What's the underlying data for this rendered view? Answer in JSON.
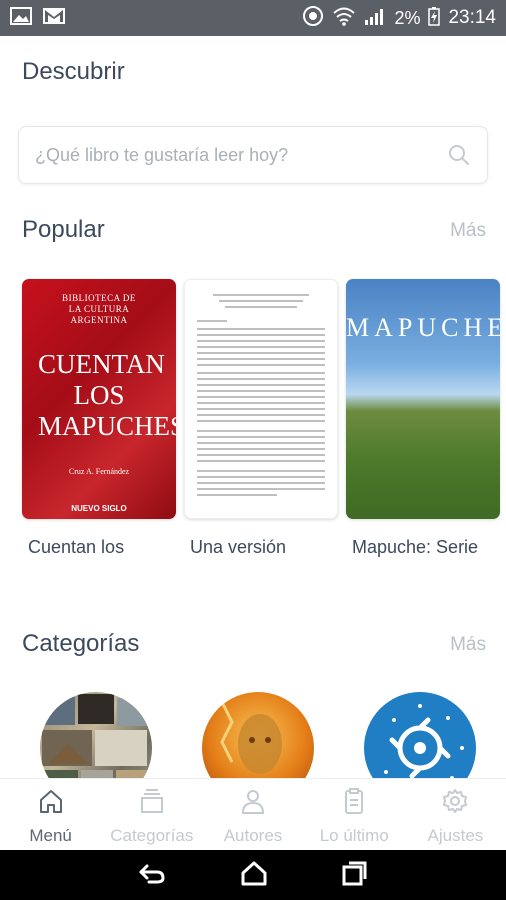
{
  "status_bar": {
    "battery": "2%",
    "time": "23:14"
  },
  "page": {
    "title": "Descubrir"
  },
  "search": {
    "placeholder": "¿Qué libro te gustaría leer hoy?"
  },
  "popular": {
    "title": "Popular",
    "more": "Más",
    "books": [
      {
        "label": "Cuentan los",
        "cover": {
          "header": "BIBLIOTECA DE LA CULTURA ARGENTINA",
          "title": "CUENTAN LOS MAPUCHES",
          "author": "Cruz A. Fernández",
          "publisher": "NUEVO SIGLO"
        }
      },
      {
        "label": "Una versión",
        "cover": {}
      },
      {
        "label": "Mapuche: Serie",
        "cover": {
          "title": "MAPUCHE"
        }
      }
    ]
  },
  "categories": {
    "title": "Categorías",
    "more": "Más"
  },
  "tabbar": {
    "tabs": [
      {
        "label": "Menú",
        "icon": "home-icon",
        "active": true
      },
      {
        "label": "Categorías",
        "icon": "layers-icon",
        "active": false
      },
      {
        "label": "Autores",
        "icon": "user-icon",
        "active": false
      },
      {
        "label": "Lo último",
        "icon": "clipboard-icon",
        "active": false
      },
      {
        "label": "Ajustes",
        "icon": "gear-icon",
        "active": false
      }
    ]
  },
  "colors": {
    "text": "#3c4a5c",
    "muted": "#b9c0c7",
    "status_bar": "#5a6066"
  }
}
